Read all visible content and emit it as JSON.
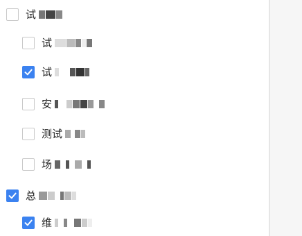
{
  "options": [
    {
      "label": "试",
      "checked": false,
      "level": 0
    },
    {
      "label": "试",
      "checked": false,
      "level": 1
    },
    {
      "label": "试",
      "checked": true,
      "level": 1
    },
    {
      "label": "安",
      "checked": false,
      "level": 1
    },
    {
      "label": "测试",
      "checked": false,
      "level": 1
    },
    {
      "label": "场",
      "checked": false,
      "level": 1
    },
    {
      "label": "总",
      "checked": true,
      "level": 0
    },
    {
      "label": "维",
      "checked": true,
      "level": 1
    }
  ],
  "colors": {
    "accent": "#3b82f0",
    "checkbox_border": "#c9c9c9",
    "redaction": "#666666"
  },
  "icons": {
    "check": "check-icon"
  }
}
